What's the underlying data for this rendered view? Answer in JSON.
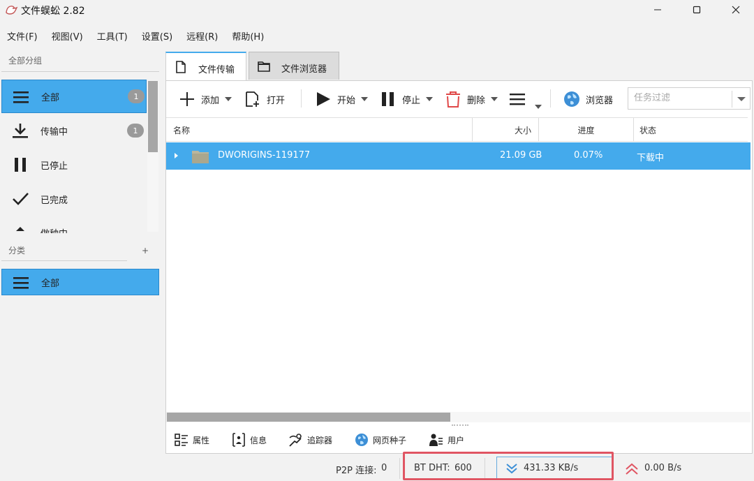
{
  "app": {
    "title": "文件蜈蚣 2.82"
  },
  "menu": [
    "文件(F)",
    "视图(V)",
    "工具(T)",
    "设置(S)",
    "远程(R)",
    "帮助(H)"
  ],
  "sidebar": {
    "group_header": "全部分组",
    "groups": [
      {
        "label": "全部",
        "badge": "1",
        "icon": "list-icon",
        "selected": true
      },
      {
        "label": "传输中",
        "badge": "1",
        "icon": "download-icon",
        "selected": false
      },
      {
        "label": "已停止",
        "badge": "",
        "icon": "pause-icon",
        "selected": false
      },
      {
        "label": "已完成",
        "badge": "",
        "icon": "check-icon",
        "selected": false
      },
      {
        "label": "做种中",
        "badge": "",
        "icon": "upload-icon",
        "selected": false
      }
    ],
    "category_header": "分类",
    "category_add": "+",
    "categories": [
      {
        "label": "全部",
        "icon": "list-icon",
        "selected": true
      }
    ]
  },
  "tabs": [
    {
      "label": "文件传输",
      "icon": "file-icon",
      "active": true
    },
    {
      "label": "文件浏览器",
      "icon": "folder-icon",
      "active": false
    }
  ],
  "toolbar": {
    "add": "添加",
    "open": "打开",
    "start": "开始",
    "stop": "停止",
    "delete": "删除",
    "browser": "浏览器",
    "filter_placeholder": "任务过滤"
  },
  "table": {
    "columns": [
      "名称",
      "大小",
      "进度",
      "状态"
    ],
    "rows": [
      {
        "name": "DWORIGINS-119177",
        "size": "21.09 GB",
        "progress": "0.07%",
        "status": "下载中"
      }
    ]
  },
  "detail_tabs": [
    "属性",
    "信息",
    "追踪器",
    "网页种子",
    "用户"
  ],
  "status": {
    "p2p_label": "P2P 连接:",
    "p2p_value": "0",
    "dht_label": "BT DHT:",
    "dht_value": "600",
    "download_speed": "431.33 KB/s",
    "upload_speed": "0.00 B/s"
  },
  "colors": {
    "accent": "#44aaec",
    "highlight": "#e05563",
    "delete_red": "#e04848"
  }
}
